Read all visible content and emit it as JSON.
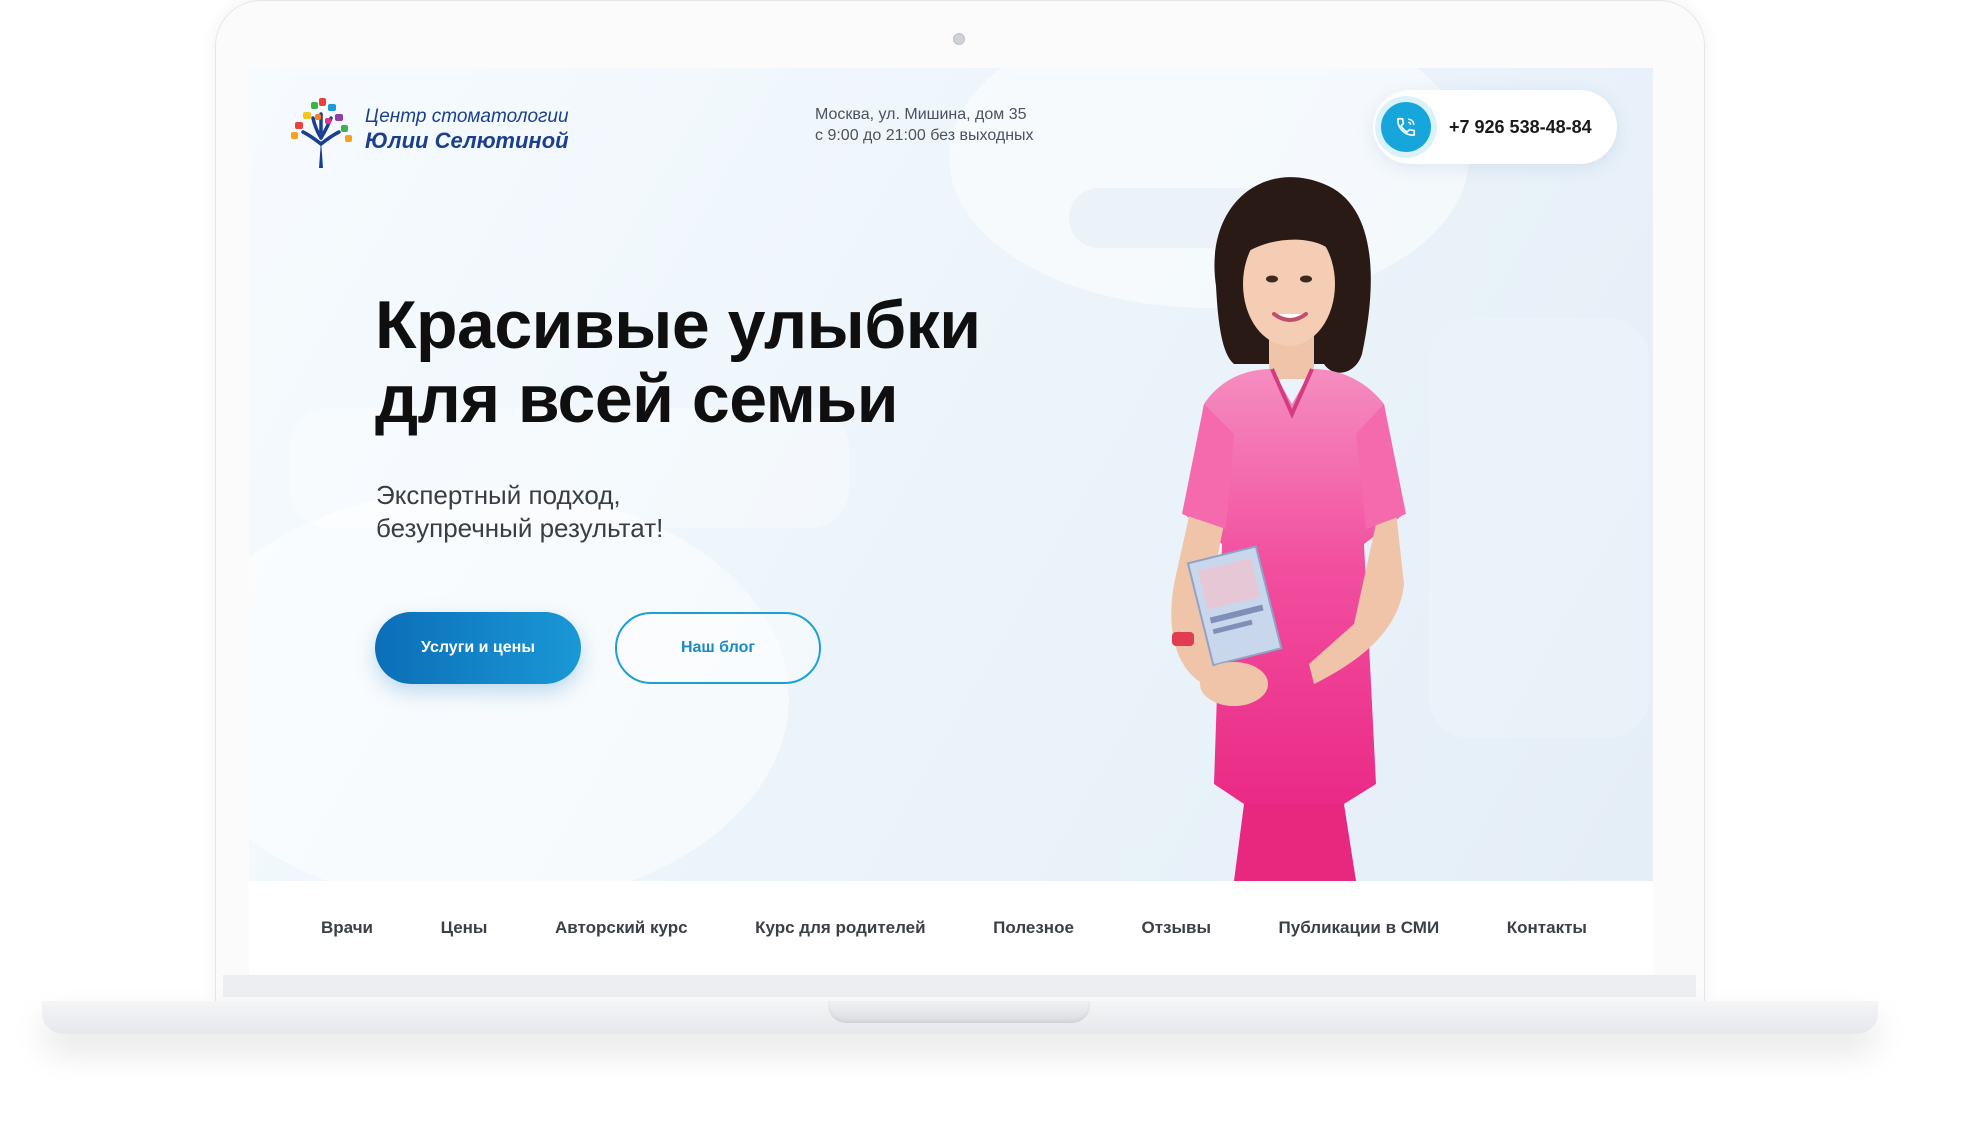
{
  "logo": {
    "line1": "Центр стоматологии",
    "line2": "Юлии Селютиной"
  },
  "address": {
    "street": "Москва, ул. Мишина, дом 35",
    "hours": "с 9:00 до 21:00 без выходных"
  },
  "phone": {
    "number": "+7 926 538-48-84",
    "icon": "phone-icon"
  },
  "hero": {
    "headline_line1": "Красивые улыбки",
    "headline_line2": "для всей семьи",
    "sub_line1": "Экспертный подход,",
    "sub_line2": "безупречный результат!",
    "primary_button": "Услуги и цены",
    "secondary_button": "Наш блог"
  },
  "nav": {
    "items": [
      {
        "label": "Врачи"
      },
      {
        "label": "Цены"
      },
      {
        "label": "Авторский курс"
      },
      {
        "label": "Курс для родителей"
      },
      {
        "label": "Полезное"
      },
      {
        "label": "Отзывы"
      },
      {
        "label": "Публикации в СМИ"
      },
      {
        "label": "Контакты"
      }
    ]
  },
  "colors": {
    "accent": "#16a6dc",
    "brand_blue": "#1b3f8f",
    "primary_button": "#0b6eb8",
    "scrubs_pink": "#f0368e"
  }
}
